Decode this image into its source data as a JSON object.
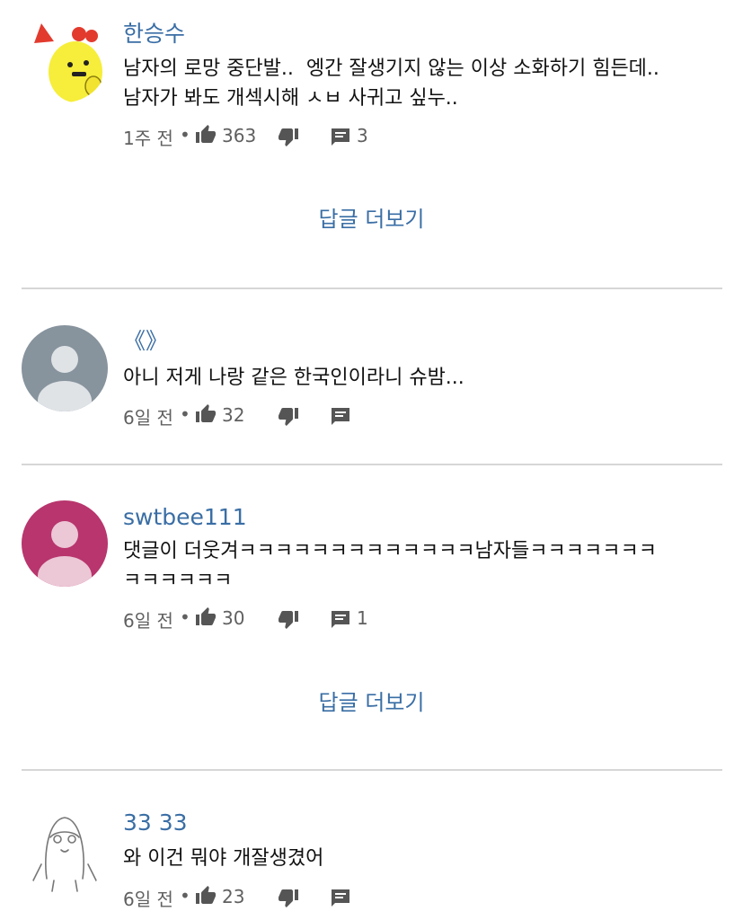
{
  "comments": [
    {
      "author": "한승수",
      "text": "남자의 로망 중단발..  엥간 잘생기지 않는 이상 소화하기 힘든데..\n남자가 봐도 개섹시해 ㅅㅂ 사귀고 싶누..",
      "time": "1주 전",
      "dot": "•",
      "likes": "363",
      "replies": "3",
      "avatar": "yellow-chick-avatar",
      "more_replies": "답글 더보기"
    },
    {
      "author": "《》",
      "text": "아니 저게 나랑 같은 한국인이라니 슈밤...",
      "time": "6일 전",
      "dot": "•",
      "likes": "32",
      "replies": "",
      "avatar": "default-gray-avatar"
    },
    {
      "author": "swtbee111",
      "text": "댓글이 더웃겨ㅋㅋㅋㅋㅋㅋㅋㅋㅋㅋㅋㅋㅋ남자들ㅋㅋㅋㅋㅋㅋㅋ\nㅋㅋㅋㅋㅋㅋ",
      "time": "6일 전",
      "dot": "•",
      "likes": "30",
      "replies": "1",
      "avatar": "default-pink-avatar",
      "more_replies": "답글 더보기"
    },
    {
      "author": "33 33",
      "text": "와 이건 뭐야 개잘생겼어",
      "time": "6일 전",
      "dot": "•",
      "likes": "23",
      "replies": "",
      "avatar": "sketch-character-avatar"
    }
  ],
  "icons": {
    "like": "thumbs-up-icon",
    "dislike": "thumbs-down-icon",
    "reply": "comment-icon"
  },
  "colors": {
    "author": "#3a6ea5",
    "link": "#3a6ea5",
    "meta": "#606060",
    "icon": "#555555",
    "divider": "#d6d6d6",
    "avatar_gray": "#87939d",
    "avatar_pink": "#b8356d"
  }
}
